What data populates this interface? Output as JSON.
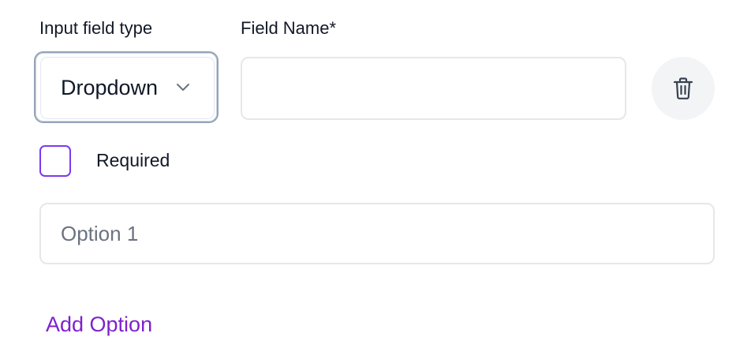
{
  "field": {
    "type_label": "Input field type",
    "type_value": "Dropdown",
    "name_label": "Field Name*",
    "name_value": "",
    "required_label": "Required",
    "required_checked": false,
    "options": [
      {
        "placeholder": "Option 1",
        "value": ""
      }
    ],
    "add_option_label": "Add Option"
  },
  "colors": {
    "accent": "#7e22ce",
    "checkbox_border": "#7c3aed",
    "input_border": "#e5e7eb",
    "delete_bg": "#f3f4f6"
  },
  "icons": {
    "dropdown": "chevron-down-icon",
    "delete": "trash-icon"
  }
}
